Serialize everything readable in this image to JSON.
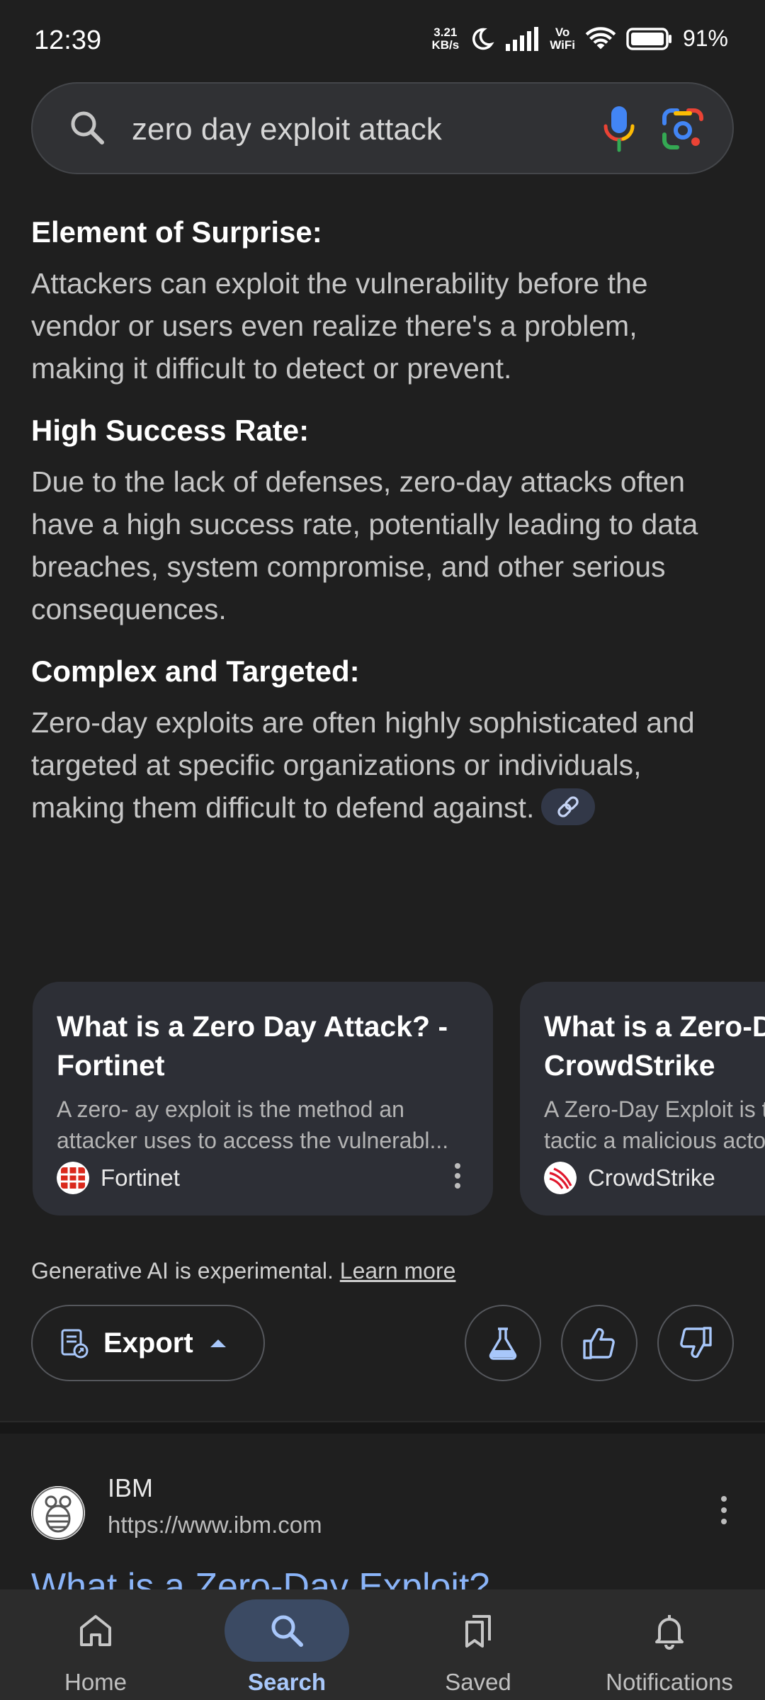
{
  "status_bar": {
    "time": "12:39",
    "net_speed_value": "3.21",
    "net_speed_unit": "KB/s",
    "vo_label": "Vo",
    "wifi_label": "WiFi",
    "battery": "91%"
  },
  "search": {
    "query": "zero day exploit attack"
  },
  "sections": [
    {
      "heading": "Element of Surprise:",
      "body": "Attackers can exploit the vulnerability before the vendor or users even realize there's a problem, making it difficult to detect or prevent."
    },
    {
      "heading": "High Success Rate:",
      "body": "Due to the lack of defenses, zero-day attacks often have a high success rate, potentially leading to data breaches, system compromise, and other serious consequences."
    },
    {
      "heading": "Complex and Targeted:",
      "body": "Zero-day exploits are often highly sophisticated and targeted at specific organizations or individuals, making them difficult to defend against."
    }
  ],
  "cards": [
    {
      "title": "What is a Zero Day Attack? - Fortinet",
      "snippet": "A zero- ay exploit is the method an attacker uses to access the vulnerabl...",
      "source": "Fortinet"
    },
    {
      "title": "What is a Zero-Day Exploit? - CrowdStrike",
      "snippet": "A Zero-Day Exploit is the technique or tactic a malicious actor uses...",
      "source": "CrowdStrike"
    }
  ],
  "disclaimer": {
    "text": "Generative AI is experimental.",
    "link": "Learn more"
  },
  "actions": {
    "export_label": "Export"
  },
  "result": {
    "site": "IBM",
    "url": "https://www.ibm.com",
    "title": "What is a Zero-Day Exploit?"
  },
  "nav": {
    "items": [
      {
        "label": "Home"
      },
      {
        "label": "Search"
      },
      {
        "label": "Saved"
      },
      {
        "label": "Notifications"
      }
    ],
    "active_index": 1
  },
  "colors": {
    "background": "#1f1f1f",
    "accent": "#a8c7fa",
    "link": "#8ab4f8"
  }
}
